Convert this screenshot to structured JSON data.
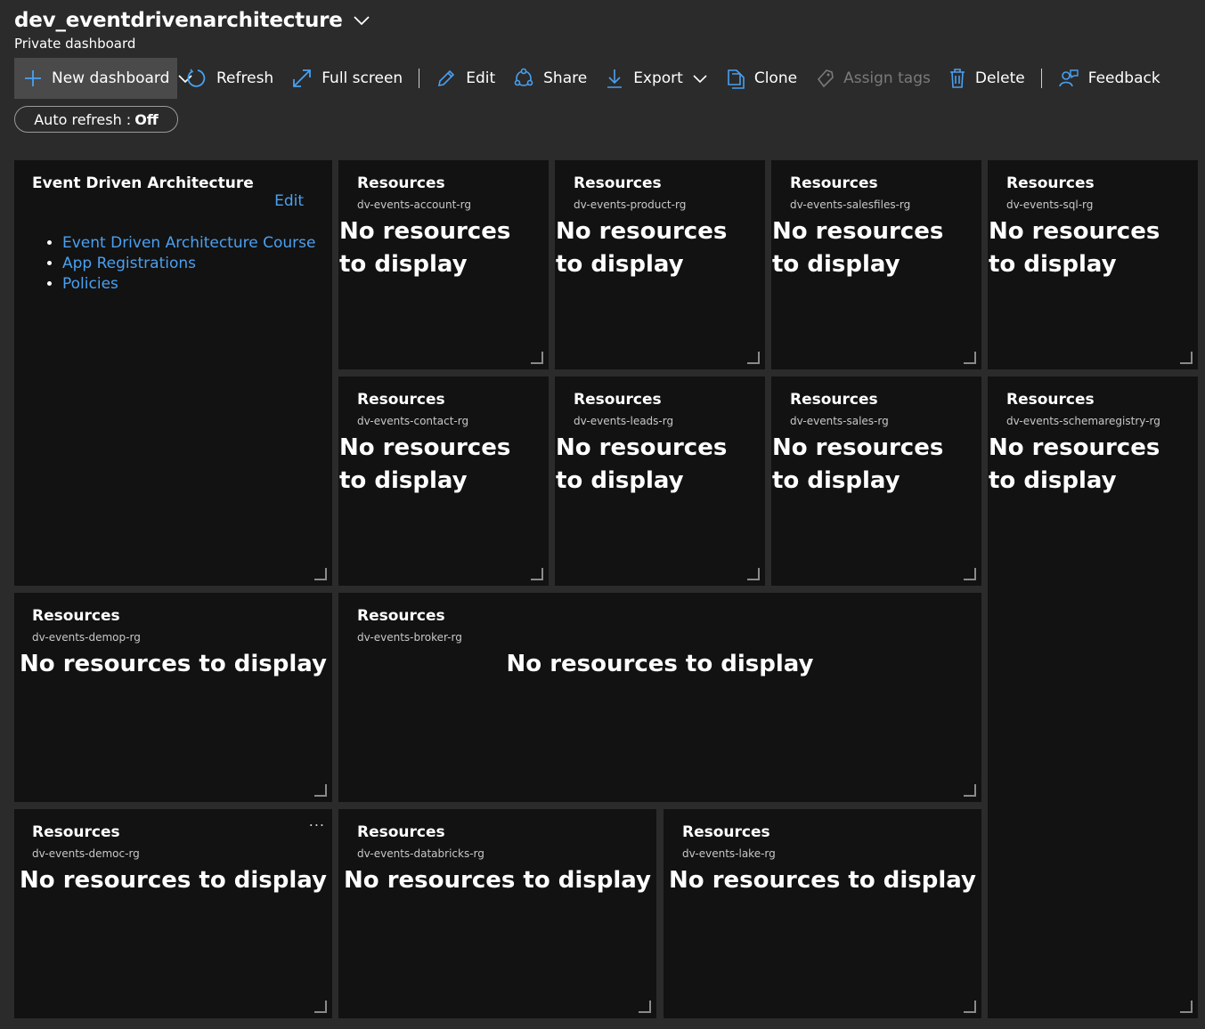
{
  "dashboard": {
    "title": "dev_eventdrivenarchitecture",
    "subtitle": "Private dashboard"
  },
  "toolbar": {
    "new_dashboard": "New dashboard",
    "refresh": "Refresh",
    "full_screen": "Full screen",
    "edit": "Edit",
    "share": "Share",
    "export": "Export",
    "clone": "Clone",
    "assign_tags": "Assign tags",
    "delete": "Delete",
    "feedback": "Feedback"
  },
  "auto_refresh": {
    "label": "Auto refresh :",
    "value": "Off"
  },
  "markdown_tile": {
    "title": "Event Driven Architecture",
    "edit_label": "Edit",
    "links": [
      "Event Driven Architecture Course",
      "App Registrations",
      "Policies"
    ]
  },
  "resource_tiles": [
    {
      "title": "Resources",
      "resource_group": "dv-events-account-rg",
      "message": "No resources to display"
    },
    {
      "title": "Resources",
      "resource_group": "dv-events-product-rg",
      "message": "No resources to display"
    },
    {
      "title": "Resources",
      "resource_group": "dv-events-salesfiles-rg",
      "message": "No resources to display"
    },
    {
      "title": "Resources",
      "resource_group": "dv-events-sql-rg",
      "message": "No resources to display"
    },
    {
      "title": "Resources",
      "resource_group": "dv-events-contact-rg",
      "message": "No resources to display"
    },
    {
      "title": "Resources",
      "resource_group": "dv-events-leads-rg",
      "message": "No resources to display"
    },
    {
      "title": "Resources",
      "resource_group": "dv-events-sales-rg",
      "message": "No resources to display"
    },
    {
      "title": "Resources",
      "resource_group": "dv-events-schemaregistry-rg",
      "message": "No resources to display"
    },
    {
      "title": "Resources",
      "resource_group": "dv-events-demop-rg",
      "message": "No resources to display"
    },
    {
      "title": "Resources",
      "resource_group": "dv-events-broker-rg",
      "message": "No resources to display"
    },
    {
      "title": "Resources",
      "resource_group": "dv-events-democ-rg",
      "message": "No resources to display",
      "menu": "..."
    },
    {
      "title": "Resources",
      "resource_group": "dv-events-databricks-rg",
      "message": "No resources to display"
    },
    {
      "title": "Resources",
      "resource_group": "dv-events-lake-rg",
      "message": "No resources to display"
    }
  ],
  "colors": {
    "background": "#2b2b2b",
    "tile": "#121212",
    "link": "#4aa0f0",
    "icon_accent": "#4aa0f0"
  }
}
